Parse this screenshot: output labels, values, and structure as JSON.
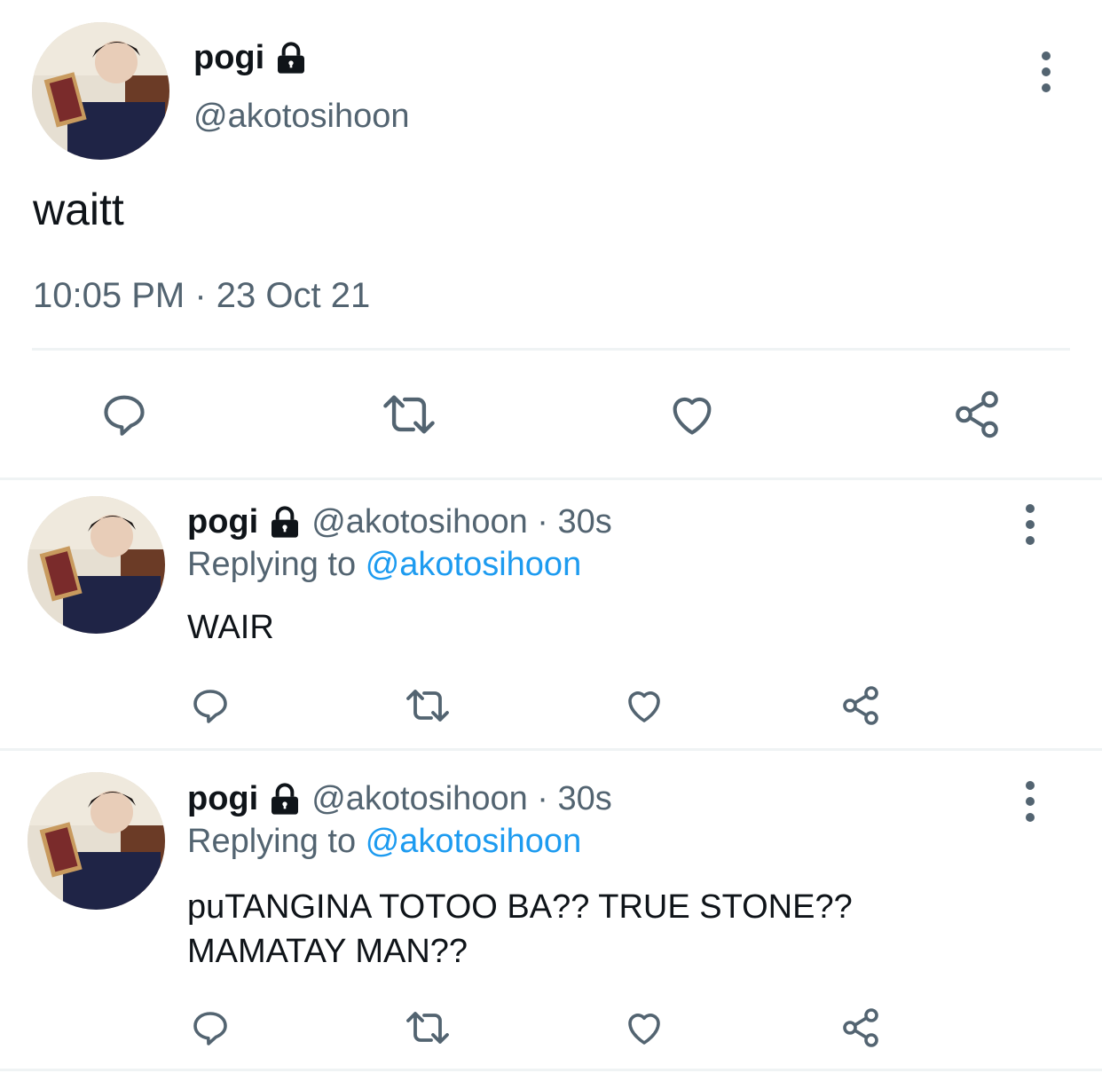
{
  "main_tweet": {
    "display_name": "pogi",
    "handle": "@akotosihoon",
    "text": "waitt",
    "timestamp": "10:05 PM · 23 Oct 21"
  },
  "replies": [
    {
      "display_name": "pogi",
      "handle_time": "@akotosihoon · 30s",
      "replying_prefix": "Replying to",
      "replying_to": "@akotosihoon",
      "text_lines": [
        "WAIR"
      ]
    },
    {
      "display_name": "pogi",
      "handle_time": "@akotosihoon · 30s",
      "replying_prefix": "Replying to",
      "replying_to": "@akotosihoon",
      "text_lines": [
        "puTANGINA TOTOO BA?? TRUE STONE??",
        "MAMATAY MAN??"
      ]
    }
  ],
  "icons": {
    "reply": "reply-icon",
    "retweet": "retweet-icon",
    "like": "heart-icon",
    "share": "share-icon",
    "more": "more-vertical-icon",
    "lock": "lock-icon"
  },
  "colors": {
    "text": "#0f1419",
    "secondary": "#536471",
    "link": "#1d9bf0",
    "divider": "#eff3f4"
  }
}
